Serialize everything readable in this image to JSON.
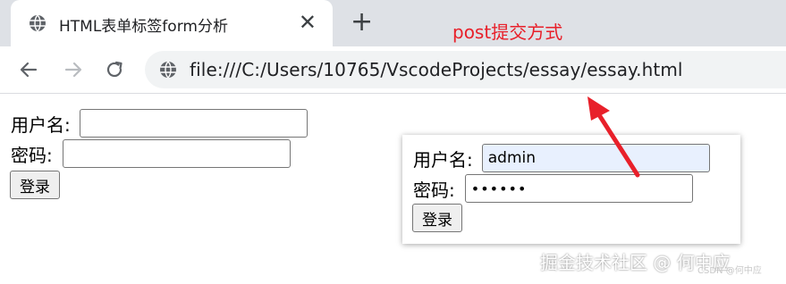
{
  "tab": {
    "title": "HTML表单标签form分析",
    "close": "✕",
    "new_tab": "+"
  },
  "annotation": {
    "label": "post提交方式",
    "color": "#e8202a"
  },
  "toolbar": {
    "url": "file:///C:/Users/10765/VscodeProjects/essay/essay.html"
  },
  "form_left": {
    "username_label": "用户名:",
    "username_value": "",
    "password_label": "密码:",
    "password_value": "",
    "submit_label": "登录"
  },
  "form_popup": {
    "username_label": "用户名:",
    "username_value": "admin",
    "password_label": "密码:",
    "password_value": "••••••",
    "submit_label": "登录"
  },
  "watermark": {
    "text": "掘金技术社区 @ 何中应",
    "sub": "CSDN @何中应"
  },
  "colors": {
    "tabbar_bg": "#dee1e6",
    "omnibox_bg": "#f1f3f4",
    "autofill_bg": "#e8f0fe",
    "accent_red": "#e8202a"
  }
}
